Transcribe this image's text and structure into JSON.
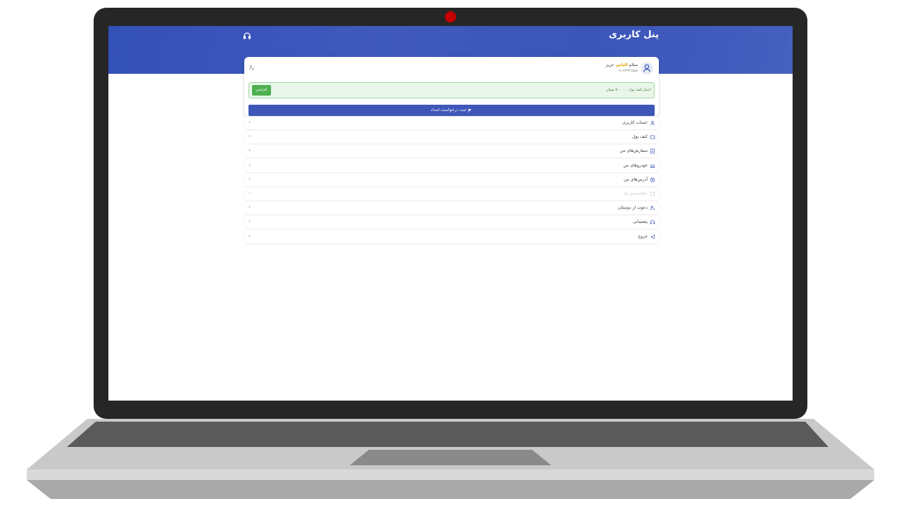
{
  "app": {
    "title": "پنل کاربری",
    "support_icon": "headset-icon"
  },
  "profile": {
    "greeting_prefix": "سلام",
    "username": "الیاس",
    "suffix": "عزیز",
    "phone": "۰۹۱۹۳۳۳۶۵۸۵",
    "avatar_icon": "user-icon",
    "edit_icon": "user-edit-icon"
  },
  "wallet": {
    "label": "اعتبار کیف پول:",
    "amount": "۵۰۰۰۰۰ تومان",
    "topup_label": "افزایش"
  },
  "help_button": {
    "label": "ثبت درخواست امداد",
    "icon": "flag-icon"
  },
  "menu": [
    {
      "label": "حساب کاربری",
      "icon": "user-icon",
      "enabled": true
    },
    {
      "label": "کیف پول",
      "icon": "wallet-icon",
      "enabled": true
    },
    {
      "label": "سفارش‌های من",
      "icon": "orders-icon",
      "enabled": true
    },
    {
      "label": "خودروهای من",
      "icon": "car-icon",
      "enabled": true
    },
    {
      "label": "آدرس‌های من",
      "icon": "location-icon",
      "enabled": true
    },
    {
      "label": "علاقه‌مندی ها",
      "icon": "heart-icon",
      "enabled": false
    },
    {
      "label": "دعوت از دوستان",
      "icon": "invite-icon",
      "enabled": true
    },
    {
      "label": "پشتیبانی",
      "icon": "headset-icon",
      "enabled": true
    },
    {
      "label": "خروج",
      "icon": "logout-icon",
      "enabled": true
    }
  ],
  "colors": {
    "primary": "#3d56b8",
    "success": "#4caf50",
    "camera": "#c40000",
    "bezel": "#262626"
  }
}
